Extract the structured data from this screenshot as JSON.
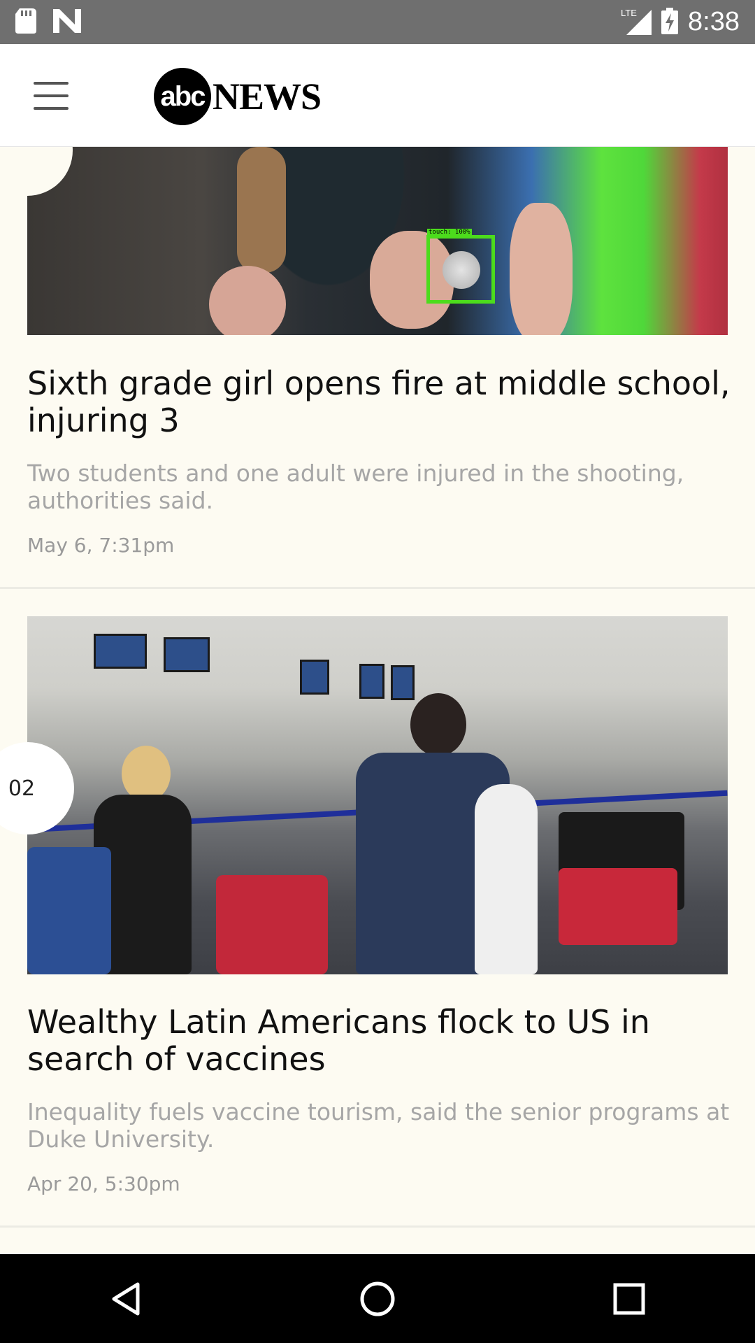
{
  "status_bar": {
    "time": "8:38",
    "network": "LTE",
    "icons": [
      "sd-card-icon",
      "n-notification-icon",
      "signal-icon",
      "battery-charging-icon"
    ]
  },
  "app_bar": {
    "logo_mark": "abc",
    "logo_word": "NEWS",
    "menu_icon": "hamburger-menu-icon"
  },
  "touch_overlay": {
    "label": "touch: 100%"
  },
  "articles": [
    {
      "headline": "Sixth grade girl opens fire at middle school, injuring 3",
      "summary": "Two students and one adult were injured in the shooting, authorities said.",
      "date": "May 6, 7:31pm"
    },
    {
      "rank": "02",
      "headline": "Wealthy Latin Americans flock to US in search of vaccines",
      "summary": "Inequality fuels vaccine tourism, said the senior programs at Duke University.",
      "date": "Apr 20, 5:30pm"
    }
  ],
  "nav_bar": {
    "icons": [
      "back-icon",
      "home-icon",
      "recents-icon"
    ]
  }
}
